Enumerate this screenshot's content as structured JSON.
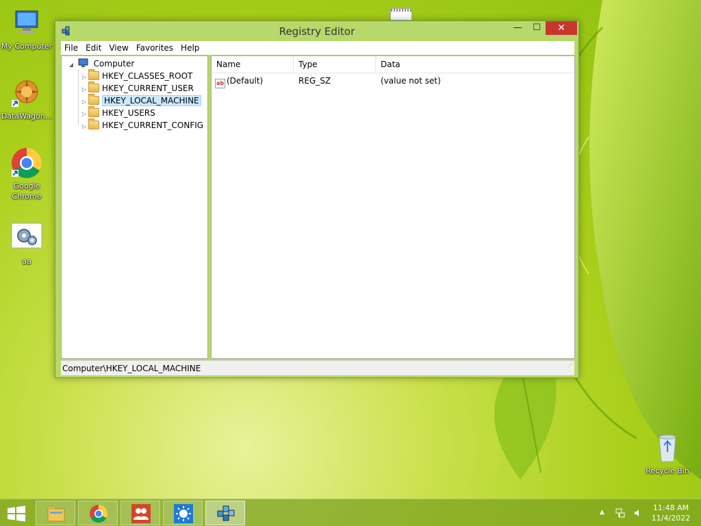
{
  "desktop": {
    "icons": [
      {
        "label": "My Computer"
      },
      {
        "label": "DataWagon..."
      },
      {
        "label": "Google Chrome"
      },
      {
        "label": "aa"
      },
      {
        "label": "Recycle Bin"
      }
    ]
  },
  "window": {
    "title": "Registry Editor",
    "controls": {
      "minimize": "—",
      "maximize": "☐",
      "close": "✕"
    },
    "menu": [
      "File",
      "Edit",
      "View",
      "Favorites",
      "Help"
    ],
    "tree": {
      "root": "Computer",
      "keys": [
        "HKEY_CLASSES_ROOT",
        "HKEY_CURRENT_USER",
        "HKEY_LOCAL_MACHINE",
        "HKEY_USERS",
        "HKEY_CURRENT_CONFIG"
      ],
      "selected": "HKEY_LOCAL_MACHINE"
    },
    "list": {
      "columns": [
        "Name",
        "Type",
        "Data"
      ],
      "rows": [
        {
          "name": "(Default)",
          "type": "REG_SZ",
          "data": "(value not set)"
        }
      ]
    },
    "status": "Computer\\HKEY_LOCAL_MACHINE"
  },
  "taskbar": {
    "time": "11:48 AM",
    "date": "11/4/2022"
  },
  "colors": {
    "accent": "#b7d86a",
    "close": "#c7372f",
    "selection": "#cce8ff"
  }
}
